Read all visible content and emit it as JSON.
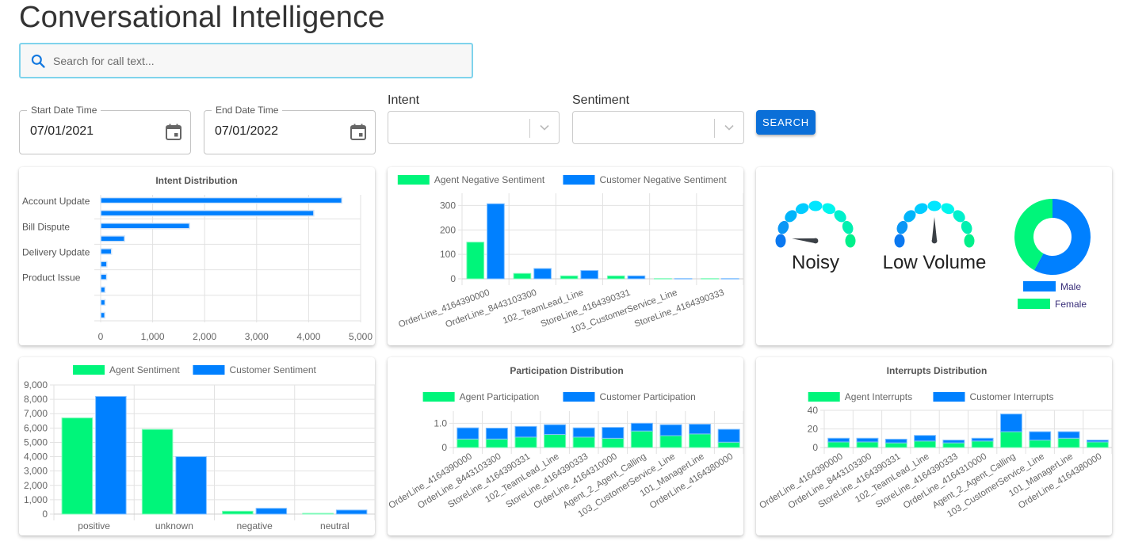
{
  "header": {
    "title": "Conversational Intelligence"
  },
  "search": {
    "placeholder": "Search for call text...",
    "value": ""
  },
  "filters": {
    "start_date": {
      "label": "Start Date Time",
      "value": "07/01/2021"
    },
    "end_date": {
      "label": "End Date Time",
      "value": "07/01/2022"
    },
    "intent": {
      "label": "Intent",
      "value": ""
    },
    "sentiment": {
      "label": "Sentiment",
      "value": ""
    },
    "search_button": "SEARCH"
  },
  "colors": {
    "green": "#00f57a",
    "blue": "#0080ff",
    "accent": "#0b6fd8"
  },
  "audio": {
    "noise": {
      "label": "Noisy",
      "level": 0.03
    },
    "volume": {
      "label": "Low Volume",
      "level": 0.5
    }
  },
  "chart_data": [
    {
      "id": "intent",
      "type": "bar",
      "orientation": "horizontal",
      "title": "Intent Distribution",
      "categories": [
        "Account Update",
        "",
        "Bill Dispute",
        "",
        "Delivery Update",
        "",
        "Product Issue",
        "",
        "",
        ""
      ],
      "values": [
        4640,
        4100,
        1710,
        460,
        210,
        120,
        115,
        85,
        85,
        80
      ],
      "xlim": [
        0,
        5000
      ],
      "xticks": [
        "0",
        "1,000",
        "2,000",
        "3,000",
        "4,000",
        "5,000"
      ],
      "grid": true
    },
    {
      "id": "negative_sentiment",
      "type": "bar",
      "title": "",
      "categories": [
        "OrderLine_4164390000",
        "OrderLine_8443103300",
        "102_TeamLead_Line",
        "StoreLine_4164390331",
        "103_CustomerService_Line",
        "StoreLine_4164390333"
      ],
      "series": [
        {
          "name": "Agent Negative Sentiment",
          "values": [
            150,
            22,
            12,
            12,
            1,
            1
          ]
        },
        {
          "name": "Customer Negative Sentiment",
          "values": [
            307,
            42,
            34,
            12,
            1,
            1
          ]
        }
      ],
      "ylim": [
        0,
        350
      ],
      "yticks": [
        "0",
        "100",
        "200",
        "300"
      ],
      "legend": "top",
      "grid": true
    },
    {
      "id": "gender",
      "type": "pie",
      "donut": true,
      "labels": [
        "Male",
        "Female"
      ],
      "values": [
        58,
        42
      ],
      "legend": "bottom"
    },
    {
      "id": "sentiment",
      "type": "bar",
      "title": "",
      "categories": [
        "positive",
        "unknown",
        "negative",
        "neutral"
      ],
      "series": [
        {
          "name": "Agent Sentiment",
          "values": [
            6700,
            5900,
            200,
            50
          ]
        },
        {
          "name": "Customer Sentiment",
          "values": [
            8200,
            4000,
            400,
            280
          ]
        }
      ],
      "ylim": [
        0,
        9000
      ],
      "yticks": [
        "0",
        "1,000",
        "2,000",
        "3,000",
        "4,000",
        "5,000",
        "6,000",
        "7,000",
        "8,000",
        "9,000"
      ],
      "legend": "top",
      "grid": true
    },
    {
      "id": "participation",
      "type": "bar",
      "stacked": true,
      "title": "Participation Distribution",
      "categories": [
        "OrderLine_4164390000",
        "OrderLine_8443103300",
        "StoreLine_4164390331",
        "102_TeamLead_Line",
        "StoreLine_4164390333",
        "OrderLine_4164310000",
        "Agent_2_Agent_Calling",
        "103_CustomerService_Line",
        "101_ManagerLine",
        "OrderLine_4164380000"
      ],
      "series": [
        {
          "name": "Agent Participation",
          "values": [
            0.35,
            0.35,
            0.43,
            0.54,
            0.43,
            0.38,
            0.68,
            0.49,
            0.56,
            0.22
          ]
        },
        {
          "name": "Customer Participation",
          "values": [
            0.46,
            0.45,
            0.44,
            0.4,
            0.38,
            0.45,
            0.32,
            0.45,
            0.4,
            0.53
          ]
        }
      ],
      "ylim": [
        0,
        1.5
      ],
      "yticks": [
        "0",
        "1.0"
      ],
      "ytick_values": [
        0,
        1.0
      ],
      "legend": "top",
      "grid": true
    },
    {
      "id": "interrupts",
      "type": "bar",
      "stacked": true,
      "title": "Interrupts Distribution",
      "categories": [
        "OrderLine_4164390000",
        "OrderLine_8443103300",
        "StoreLine_4164390331",
        "102_TeamLead_Line",
        "StoreLine_4164390333",
        "OrderLine_4164310000",
        "Agent_2_Agent_Calling",
        "103_CustomerService_Line",
        "101_ManagerLine",
        "OrderLine_4164380000"
      ],
      "series": [
        {
          "name": "Agent Interrupts",
          "values": [
            6,
            6,
            5,
            7,
            5,
            7,
            17,
            8,
            10,
            6
          ]
        },
        {
          "name": "Customer Interrupts",
          "values": [
            4,
            4,
            4,
            6,
            3,
            3,
            19,
            9,
            7,
            2
          ]
        }
      ],
      "ylim": [
        0,
        40
      ],
      "yticks": [
        "0",
        "20",
        "40"
      ],
      "ytick_values": [
        0,
        20,
        40
      ],
      "legend": "top",
      "grid": true
    }
  ]
}
